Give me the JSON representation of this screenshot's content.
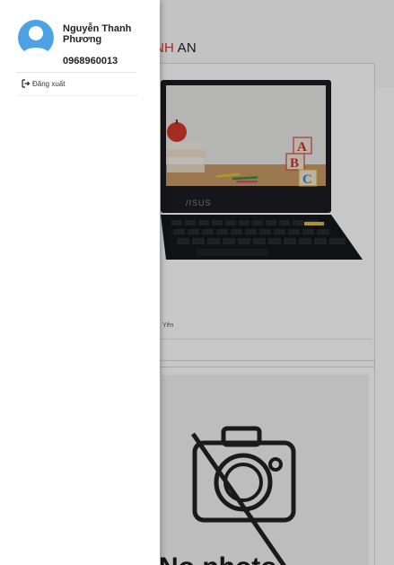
{
  "background": {
    "brand": {
      "part_red": "NH",
      "part_dark": " AN"
    },
    "product_card": {
      "meta_text": "Yên"
    },
    "placeholder_card": {
      "text": "No photo"
    }
  },
  "drawer": {
    "user": {
      "name": "Nguyễn Thanh Phương",
      "phone": "0968960013"
    },
    "menu": {
      "logout_label": "Đăng xuất",
      "logout_icon": "sign-out-icon"
    }
  },
  "colors": {
    "avatar": "#4da2e6",
    "brand_red": "#d8352b",
    "overlay": "rgba(0,0,0,0.22)"
  }
}
